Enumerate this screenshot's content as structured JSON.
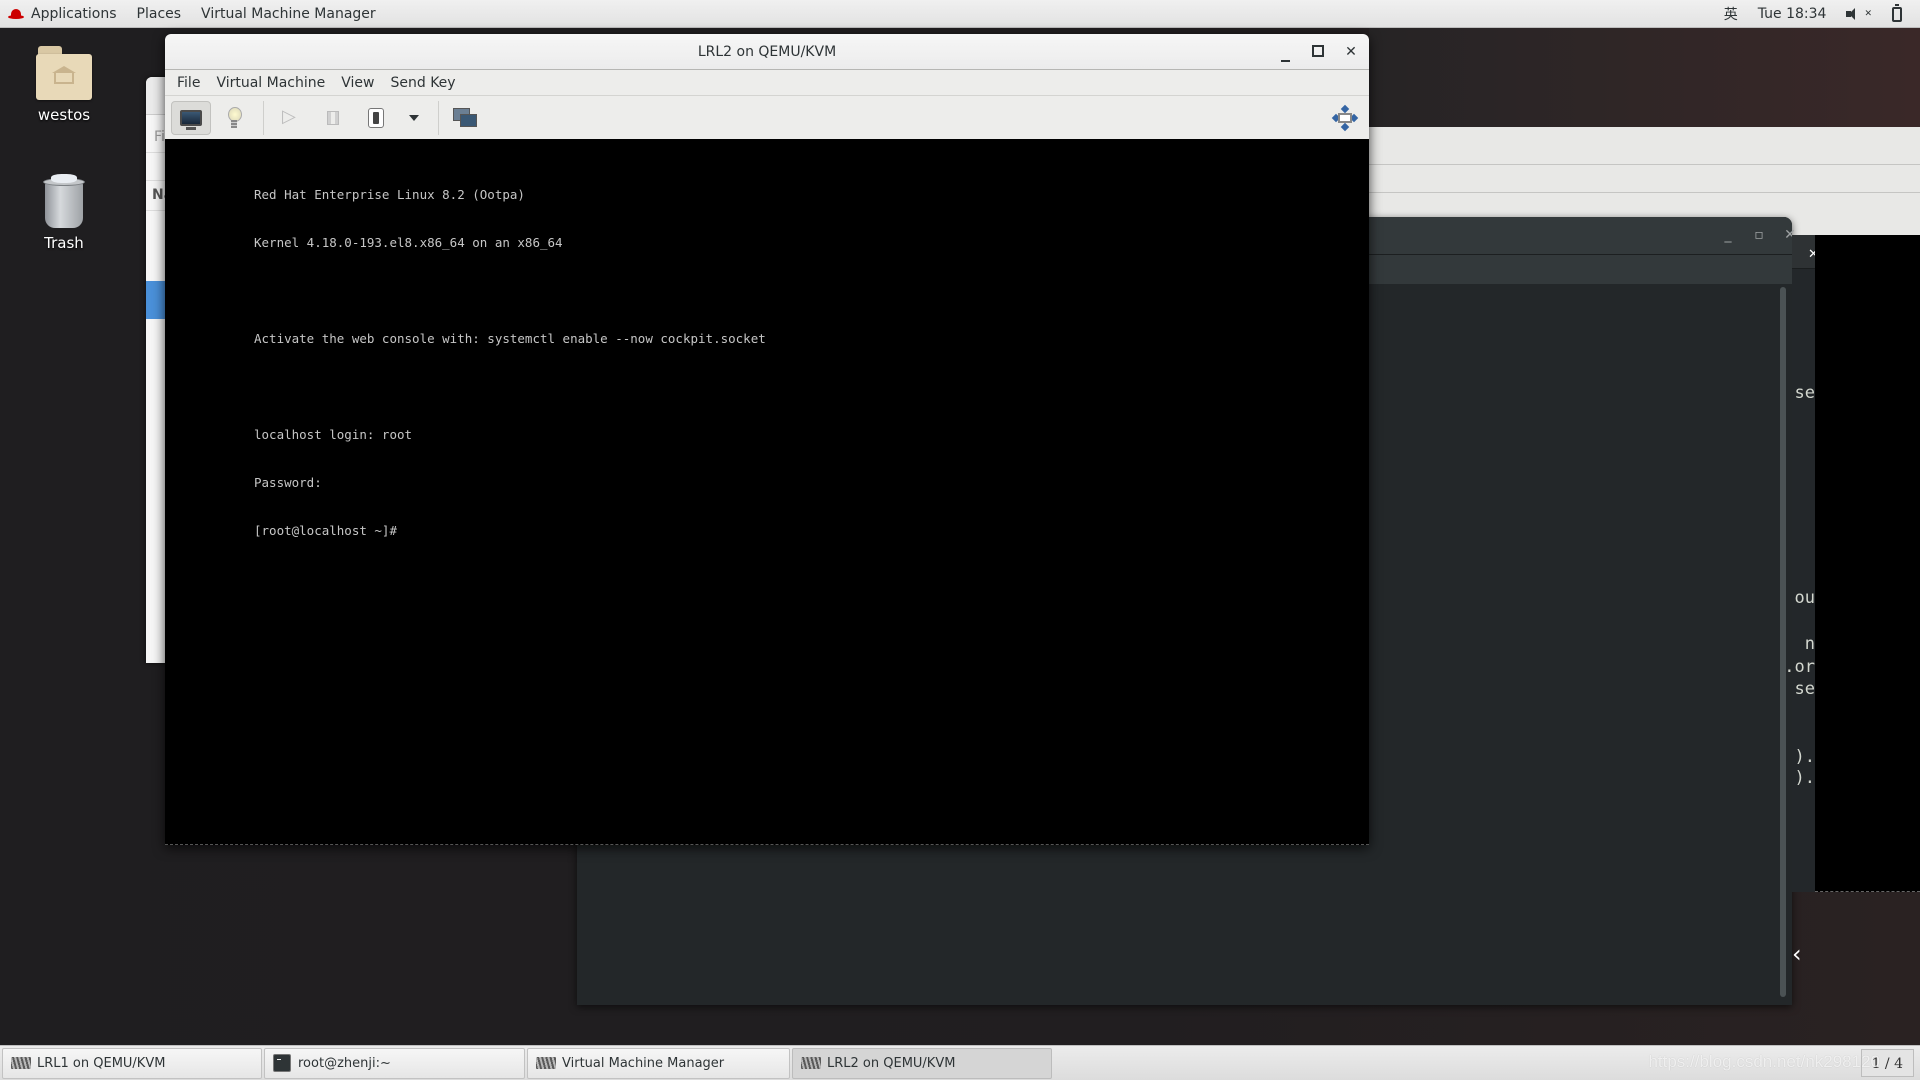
{
  "topbar": {
    "menus": [
      "Applications",
      "Places",
      "Virtual Machine Manager"
    ],
    "input_method": "英",
    "clock": "Tue 18:34"
  },
  "desktop": {
    "icons": [
      {
        "label": "westos",
        "icon": "home-folder-icon"
      },
      {
        "label": "Trash",
        "icon": "trash-icon"
      }
    ]
  },
  "background": {
    "file_manager_fragments": [
      "Fi",
      "Na"
    ],
    "terminal_fragments": [
      "se",
      "ou",
      "n",
      ".or",
      "se",
      ").",
      ")."
    ]
  },
  "vm_window": {
    "title": "LRL2 on QEMU/KVM",
    "menu": [
      "File",
      "Virtual Machine",
      "View",
      "Send Key"
    ],
    "toolbar": {
      "console": "Show the graphical console",
      "details": "Show virtual hardware details",
      "run": "Run",
      "pause": "Pause",
      "shutdown": "Shut down",
      "screenshot": "Switch to fullscreen"
    },
    "console_lines": [
      "Red Hat Enterprise Linux 8.2 (Ootpa)",
      "Kernel 4.18.0-193.el8.x86_64 on an x86_64",
      "",
      "Activate the web console with: systemctl enable --now cockpit.socket",
      "",
      "localhost login: root",
      "Password:",
      "[root@localhost ~]#"
    ]
  },
  "taskbar": {
    "tasks": [
      {
        "label": "LRL1 on QEMU/KVM",
        "icon": "vmm-icon",
        "active": false
      },
      {
        "label": "root@zhenji:~",
        "icon": "terminal-icon",
        "active": false
      },
      {
        "label": "Virtual Machine Manager",
        "icon": "vmm-icon",
        "active": false
      },
      {
        "label": "LRL2 on QEMU/KVM",
        "icon": "vmm-icon",
        "active": true
      }
    ],
    "workspace_pager": "1 / 4",
    "watermark": "https://blog.csdn.net/nk298120"
  }
}
